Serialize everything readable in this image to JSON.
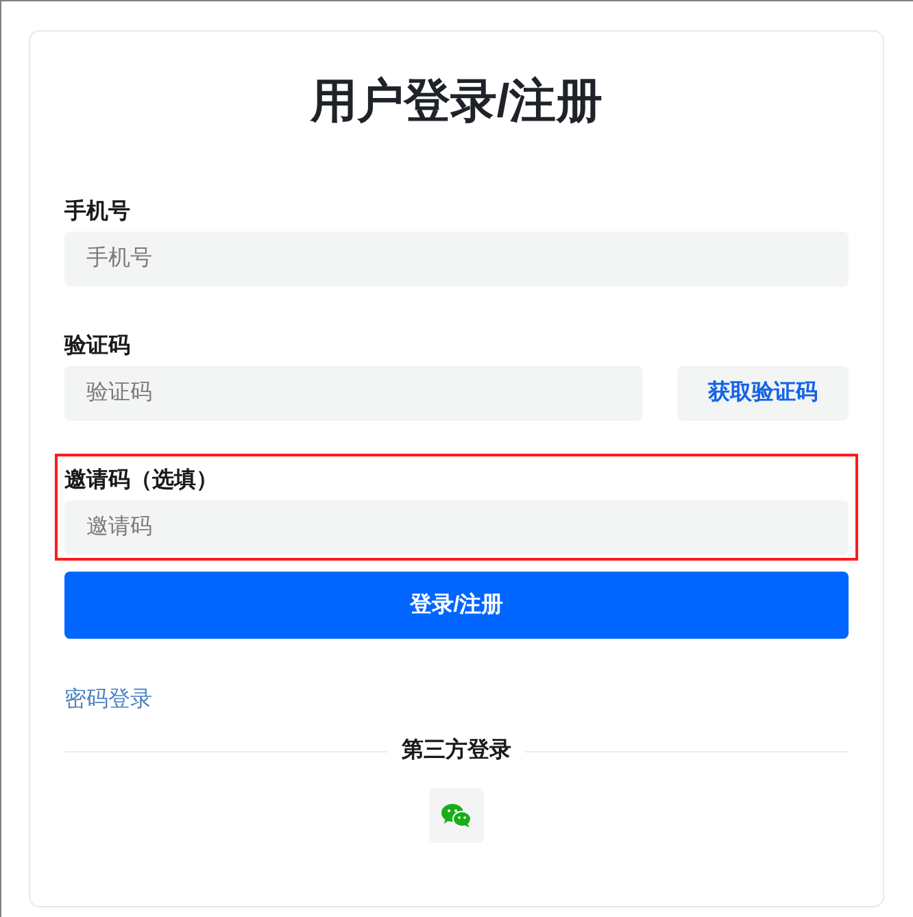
{
  "title": "用户登录/注册",
  "fields": [
    {
      "kind": "text",
      "label": "手机号",
      "placeholder": "手机号",
      "highlighted": false
    },
    {
      "kind": "code",
      "label": "验证码",
      "placeholder": "验证码",
      "button": "获取验证码",
      "highlighted": false
    },
    {
      "kind": "text",
      "label": "邀请码（选填）",
      "placeholder": "邀请码",
      "highlighted": true
    }
  ],
  "submit": "登录/注册",
  "alt_login_link": "密码登录",
  "third_party": {
    "heading": "第三方登录",
    "providers": [
      {
        "kind": "wechat"
      }
    ]
  }
}
